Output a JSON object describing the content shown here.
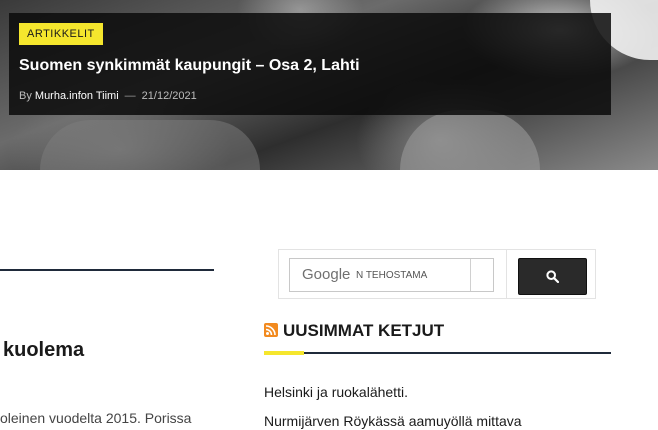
{
  "hero": {
    "category": "ARTIKKELIT",
    "title": "Suomen synkimmät kaupungit – Osa 2, Lahti",
    "by_label": "By",
    "author": "Murha.infon Tiimi",
    "separator": "—",
    "date": "21/12/2021"
  },
  "left_column": {
    "heading": "kuolema",
    "excerpt": "oleinen vuodelta 2015. Porissa"
  },
  "search": {
    "logo_text": "Google",
    "hint_text": "N TEHOSTAMA",
    "button_icon": "search-icon"
  },
  "widget": {
    "icon": "rss-icon",
    "title": "UUSIMMAT KETJUT",
    "items": [
      "Helsinki ja ruokalähetti.",
      "Nurmijärven Röykässä aamuyöllä mittava"
    ]
  },
  "colors": {
    "accent": "#f5e62d",
    "rule": "#1f2a3a",
    "rss": "#f28a1f"
  }
}
